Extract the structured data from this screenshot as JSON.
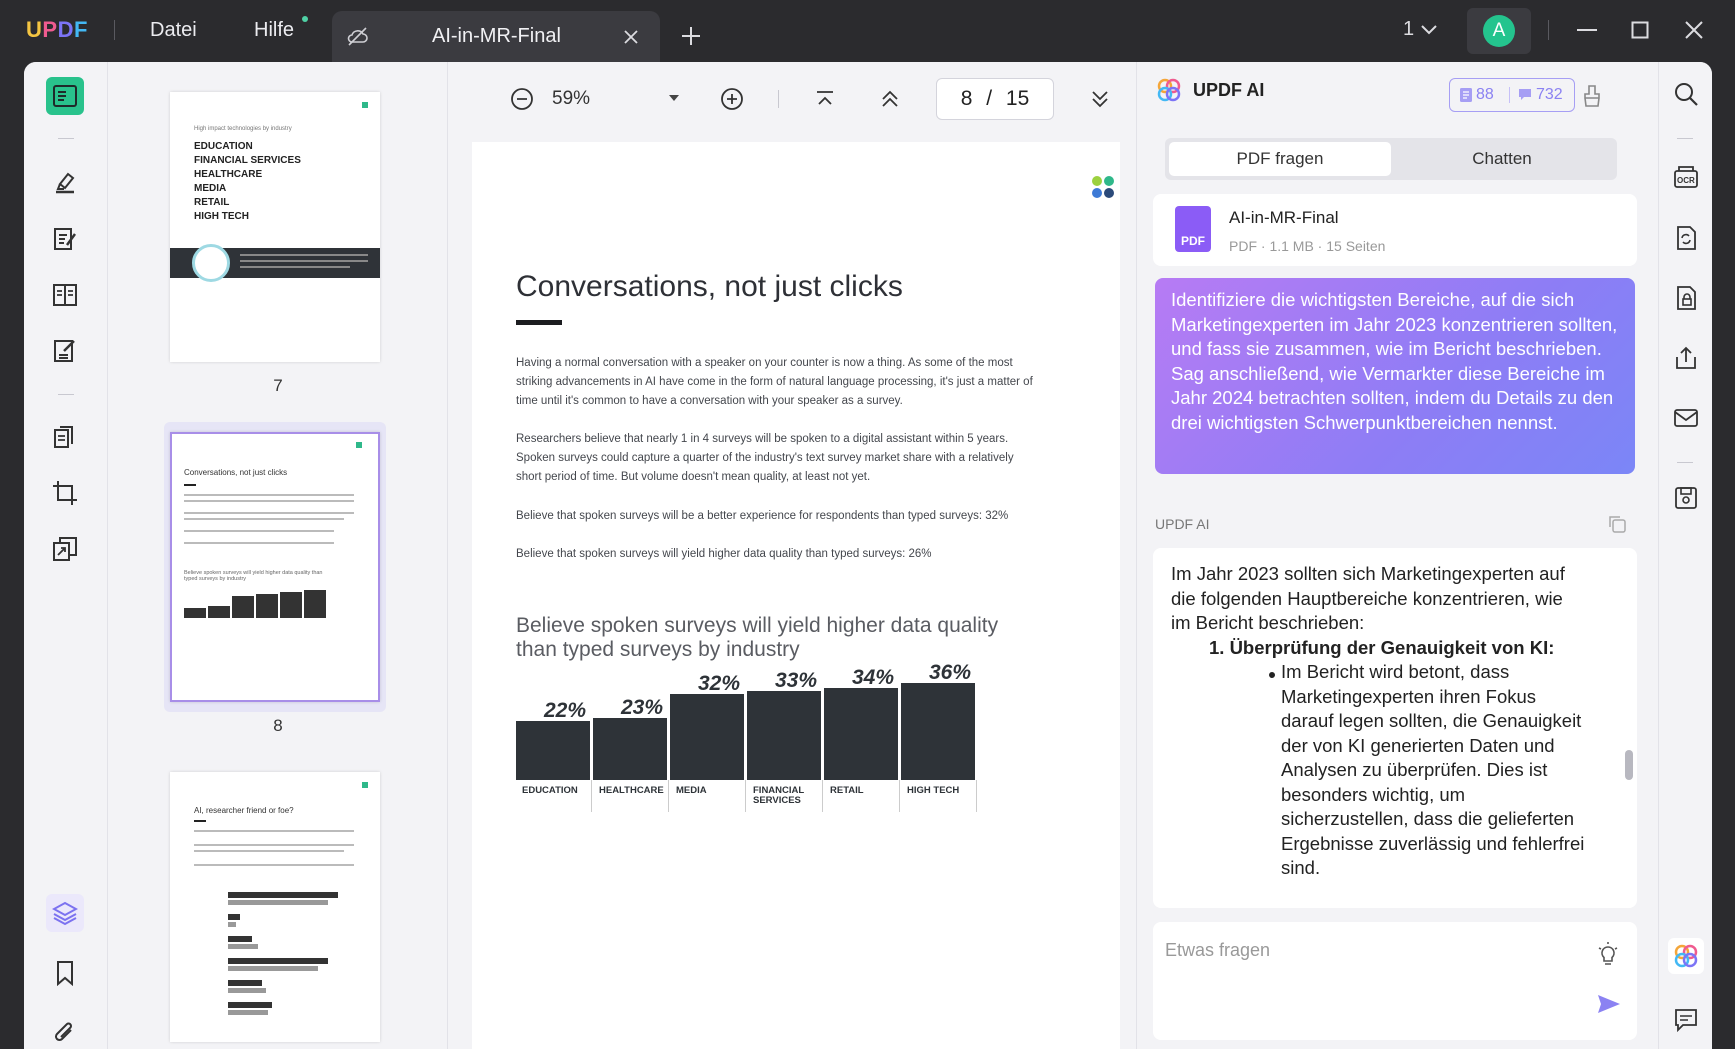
{
  "app": {
    "logo": "UPDF",
    "menu_file": "Datei",
    "menu_help": "Hilfe",
    "tab_title": "AI-in-MR-Final",
    "page_switch": "1",
    "avatar_initial": "A"
  },
  "viewer": {
    "zoom": "59%",
    "current_page": "8",
    "page_sep": "/",
    "total_pages": "15"
  },
  "thumbnails": [
    {
      "label": "7"
    },
    {
      "label": "8"
    }
  ],
  "thumb7": {
    "heading": "High impact technologies by industry",
    "lines": [
      "EDUCATION",
      "FINANCIAL SERVICES",
      "HEALTHCARE",
      "MEDIA",
      "RETAIL",
      "HIGH TECH"
    ]
  },
  "thumb8": {
    "title": "Conversations, not just clicks",
    "chart_caption": "Believe spoken surveys will yield higher data quality than typed surveys by industry"
  },
  "thumb9": {
    "title": "AI, researcher friend or foe?"
  },
  "page": {
    "title": "Conversations, not just clicks",
    "para1": "Having a normal conversation with a speaker on your counter is now a thing. As some of the most striking advancements in AI have come in the form of natural language processing, it's just a matter of time until it's common to have a conversation with your speaker as a survey.",
    "para2": "Researchers believe that nearly 1 in 4 surveys will be spoken to a digital assistant within 5 years. Spoken surveys could capture a quarter of the industry's text survey market share with a relatively short period of time. But volume doesn't mean quality, at least not yet.",
    "para3": "Believe that spoken surveys will be a better experience for respondents than typed surveys: 32%",
    "para4": "Believe that spoken surveys will yield higher data quality than typed surveys: 26%",
    "chart_title": "Believe spoken surveys will yield higher data quality than typed surveys by industry"
  },
  "chart_data": {
    "type": "bar",
    "title": "Believe spoken surveys will yield higher data quality than typed surveys by industry",
    "categories": [
      "EDUCATION",
      "HEALTHCARE",
      "MEDIA",
      "FINANCIAL SERVICES",
      "RETAIL",
      "HIGH TECH"
    ],
    "values": [
      22,
      23,
      32,
      33,
      34,
      36
    ],
    "value_labels": [
      "22%",
      "23%",
      "32%",
      "33%",
      "34%",
      "36%"
    ],
    "unit": "%",
    "ylim": [
      0,
      40
    ],
    "bar_color": "#2e3338"
  },
  "ai": {
    "title": "UPDF AI",
    "credits_docs": "88",
    "credits_msgs": "732",
    "tab_ask_pdf": "PDF fragen",
    "tab_chat": "Chatten",
    "file_name": "AI-in-MR-Final",
    "file_meta": "PDF · 1.1 MB · 15 Seiten",
    "file_badge": "PDF",
    "user_prompt": "Identifiziere die wichtigsten Bereiche, auf die sich Marketingexperten im Jahr 2023 konzentrieren sollten, und fass sie zusammen, wie im Bericht beschrieben. Sag anschließend, wie Vermarkter diese Bereiche im Jahr 2024 betrachten sollten, indem du Details zu den drei wichtigsten Schwerpunktbereichen nennst.",
    "responder": "UPDF AI",
    "answer_intro": "Im Jahr 2023 sollten sich Marketingexperten auf die folgenden Hauptbereiche konzentrieren, wie im Bericht beschrieben:",
    "answer_heading": "1. Überprüfung der Genauigkeit von KI:",
    "answer_bullet": "Im Bericht wird betont, dass Marketingexperten ihren Fokus darauf legen sollten, die Genauigkeit der von KI generierten Daten und Analysen zu überprüfen. Dies ist besonders wichtig, um sicherzustellen, dass die gelieferten Ergebnisse zuverlässig und fehlerfrei sind.",
    "input_placeholder": "Etwas fragen"
  },
  "colors": {
    "accent_green": "#29c28c",
    "ai_purple": "#8b82f2",
    "titlebar_bg": "#2b2b2e"
  }
}
